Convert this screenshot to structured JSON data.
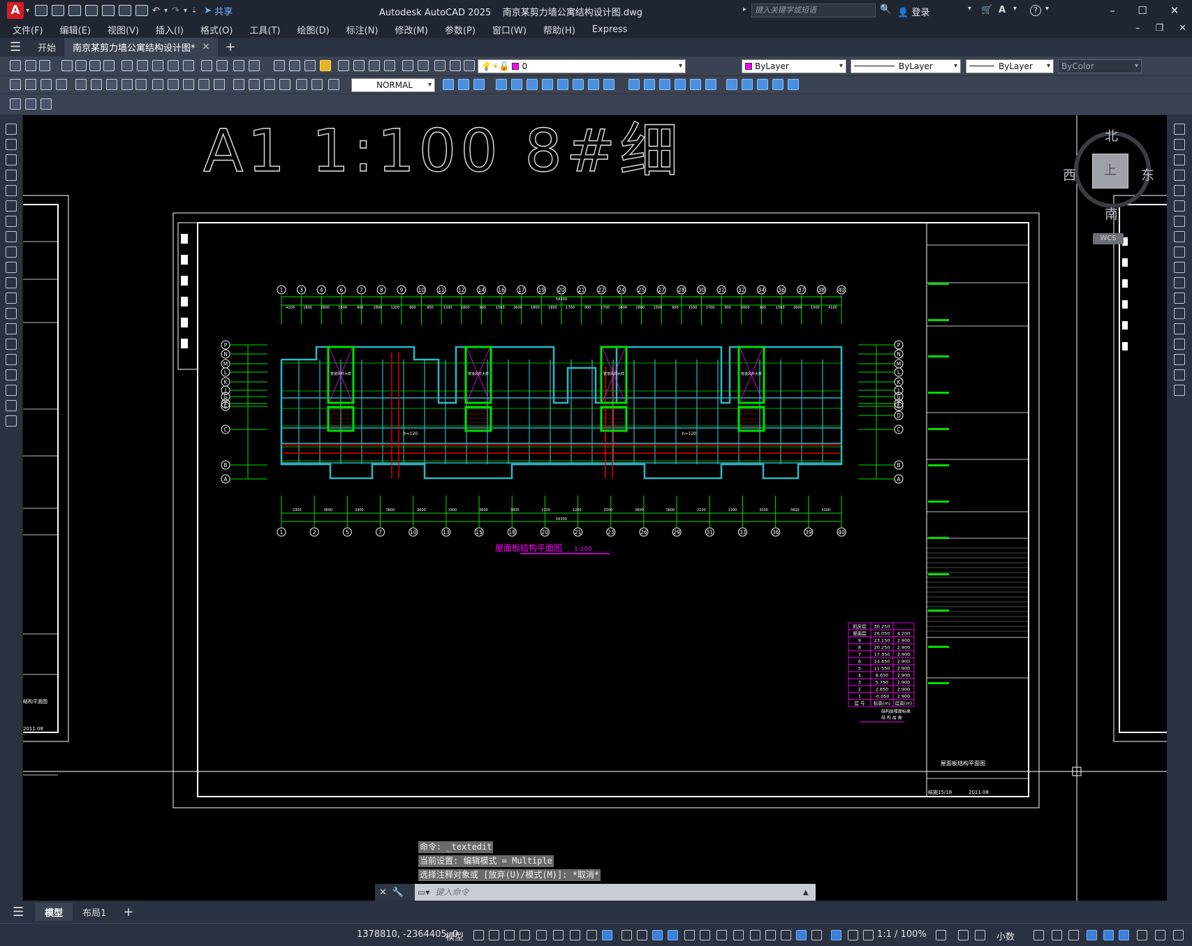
{
  "app": {
    "logo": "A",
    "title": "Autodesk AutoCAD 2025",
    "document": "南京某剪力墙公寓结构设计图.dwg",
    "share_label": "共享",
    "search_placeholder": "键入关键字或短语",
    "login_label": "登录"
  },
  "menu": [
    "文件(F)",
    "编辑(E)",
    "视图(V)",
    "插入(I)",
    "格式(O)",
    "工具(T)",
    "绘图(D)",
    "标注(N)",
    "修改(M)",
    "参数(P)",
    "窗口(W)",
    "帮助(H)",
    "Express"
  ],
  "tabs": {
    "start": "开始",
    "active": "南京某剪力墙公寓结构设计图*"
  },
  "toolbar": {
    "layer_value": "0",
    "layer_color": "#ff00ff",
    "color_value": "ByLayer",
    "linetype_value": "ByLayer",
    "lineweight_value": "ByLayer",
    "plotstyle_value": "ByColor",
    "dimstyle_value": "NORMAL"
  },
  "drawing": {
    "sheet_title": "A1 1:100  8#细",
    "plan_title": "屋面板结构平面图",
    "plan_scale": "1:100",
    "top_axes": [
      "1",
      "3",
      "4",
      "6",
      "7",
      "8",
      "9",
      "10",
      "11",
      "12",
      "14",
      "16",
      "17",
      "19",
      "20",
      "21",
      "22",
      "24",
      "25",
      "27",
      "28",
      "30",
      "31",
      "32",
      "34",
      "36",
      "37",
      "38",
      "40"
    ],
    "top_dims": [
      "4100",
      "1800",
      "2800",
      "1500",
      "900",
      "1800",
      "1200",
      "900",
      "900",
      "1200",
      "1800",
      "900",
      "1500",
      "2600",
      "1800",
      "1800",
      "1700",
      "900",
      "1700",
      "1800",
      "2600",
      "1500",
      "900",
      "1500",
      "1700",
      "900",
      "3000",
      "900",
      "1500",
      "2600",
      "1500",
      "4100"
    ],
    "top_total": "56300",
    "bottom_axes": [
      "1",
      "2",
      "5",
      "7",
      "10",
      "13",
      "15",
      "18",
      "20",
      "21",
      "23",
      "26",
      "29",
      "31",
      "33",
      "36",
      "39",
      "40"
    ],
    "bottom_dims": [
      "3300",
      "3600",
      "3300",
      "3600",
      "3600",
      "3300",
      "3600",
      "3600",
      "2100",
      "1200",
      "3300",
      "3600",
      "3600",
      "2100",
      "1200",
      "3300",
      "3600",
      "3300"
    ],
    "bottom_total": "56300",
    "row_axes_left": [
      "P",
      "N",
      "M",
      "L",
      "K",
      "J",
      "G",
      "F",
      "E",
      "C",
      "B",
      "A"
    ],
    "row_axes_right": [
      "P",
      "N",
      "M",
      "L",
      "K",
      "J",
      "G",
      "F",
      "E",
      "D",
      "C",
      "B",
      "A"
    ],
    "stair_labels": [
      "管道风井大样",
      "管道风井大样",
      "管道风井大样",
      "管道风井大样"
    ],
    "slab_notes": [
      "h=120",
      "h=120"
    ],
    "floor_table": {
      "headers": [
        "层 号",
        "标高(m)",
        "层高(m)"
      ],
      "rows": [
        [
          "机房层",
          "30.250",
          ""
        ],
        [
          "屋面层",
          "26.050",
          "4.200"
        ],
        [
          "9",
          "23.150",
          "2.900"
        ],
        [
          "8",
          "20.250",
          "2.900"
        ],
        [
          "7",
          "17.350",
          "2.900"
        ],
        [
          "6",
          "14.450",
          "2.900"
        ],
        [
          "5",
          "11.550",
          "2.900"
        ],
        [
          "4",
          "8.650",
          "2.900"
        ],
        [
          "3",
          "5.750",
          "2.900"
        ],
        [
          "2",
          "2.850",
          "2.900"
        ],
        [
          "1",
          "-0.050",
          "2.900"
        ]
      ],
      "caption1": "结构层楼面标高",
      "caption2": "结 构 层 高"
    },
    "titleblock_drawing_name": "屋面板结构平面图",
    "titleblock_number": "结施15/18",
    "titleblock_date": "2011.08",
    "left_sheet_name": "结构平面图",
    "left_sheet_date": "2011.08"
  },
  "viewcube": {
    "north": "北",
    "south": "南",
    "east": "东",
    "west": "西",
    "face": "上",
    "wcs": "WCS"
  },
  "command": {
    "history": [
      "命令: _textedit",
      "当前设置: 编辑模式 = Multiple",
      "选择注释对象或 [放弃(U)/模式(M)]: *取消*"
    ],
    "placeholder": "键入命令"
  },
  "layouts": [
    "模型",
    "布局1"
  ],
  "status": {
    "coords": "1378810, -2364405, 0",
    "model": "模型",
    "scale": "1:1 / 100%",
    "units": "小数"
  },
  "colors": {
    "wall_cyan": "#2bb8c8",
    "grid_green": "#00e000",
    "beam_red": "#e00000",
    "frame_white": "#ffffff",
    "magenta": "#ff00ff"
  }
}
